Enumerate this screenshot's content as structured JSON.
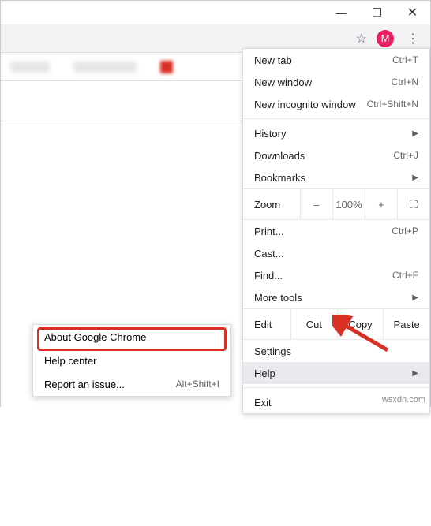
{
  "window_controls": {
    "minimize": "—",
    "maximize": "❐",
    "close": "✕"
  },
  "toolbar": {
    "star": "☆",
    "avatar_letter": "M",
    "kebab": "⋮"
  },
  "menu": {
    "new_tab": {
      "label": "New tab",
      "shortcut": "Ctrl+T"
    },
    "new_window": {
      "label": "New window",
      "shortcut": "Ctrl+N"
    },
    "new_incognito": {
      "label": "New incognito window",
      "shortcut": "Ctrl+Shift+N"
    },
    "history": {
      "label": "History"
    },
    "downloads": {
      "label": "Downloads",
      "shortcut": "Ctrl+J"
    },
    "bookmarks": {
      "label": "Bookmarks"
    },
    "zoom": {
      "label": "Zoom",
      "minus": "–",
      "value": "100%",
      "plus": "+",
      "fullscreen": "⛶"
    },
    "print": {
      "label": "Print...",
      "shortcut": "Ctrl+P"
    },
    "cast": {
      "label": "Cast..."
    },
    "find": {
      "label": "Find...",
      "shortcut": "Ctrl+F"
    },
    "more_tools": {
      "label": "More tools"
    },
    "edit": {
      "label": "Edit",
      "cut": "Cut",
      "copy": "Copy",
      "paste": "Paste"
    },
    "settings": {
      "label": "Settings"
    },
    "help": {
      "label": "Help"
    },
    "exit": {
      "label": "Exit"
    }
  },
  "submenu": {
    "about": {
      "label": "About Google Chrome"
    },
    "help_center": {
      "label": "Help center"
    },
    "report": {
      "label": "Report an issue...",
      "shortcut": "Alt+Shift+I"
    }
  },
  "watermark": "wsxdn.com"
}
